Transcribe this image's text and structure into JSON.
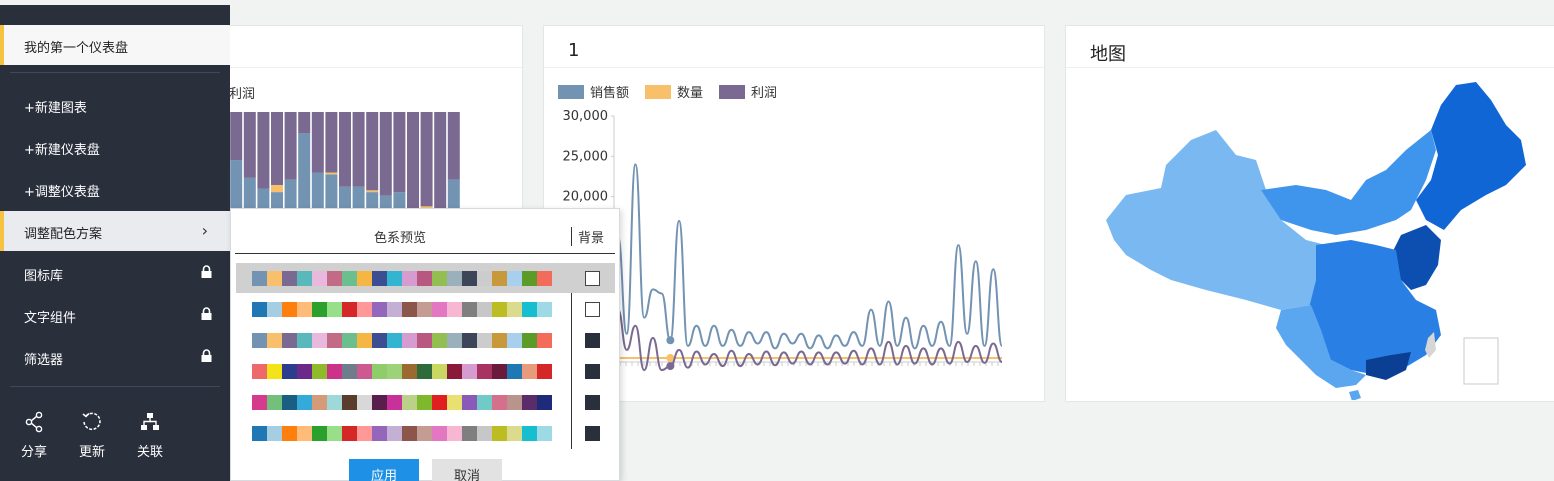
{
  "sidebar": {
    "dashboard_name": "我的第一个仪表盘",
    "items": [
      {
        "label": "+新建图表"
      },
      {
        "label": "+新建仪表盘"
      },
      {
        "label": "+调整仪表盘"
      },
      {
        "label": "调整配色方案"
      },
      {
        "label": "图标库"
      },
      {
        "label": "文字组件"
      },
      {
        "label": "筛选器"
      }
    ],
    "tools": [
      {
        "label": "分享",
        "icon": "share-icon"
      },
      {
        "label": "更新",
        "icon": "refresh-icon"
      },
      {
        "label": "关联",
        "icon": "hierarchy-icon"
      }
    ]
  },
  "cards": {
    "a": {
      "legend_partial": "利润"
    },
    "b": {
      "title": "1",
      "legend": [
        {
          "name": "销售额",
          "color": "#7393b3"
        },
        {
          "name": "数量",
          "color": "#f8c06a"
        },
        {
          "name": "利润",
          "color": "#7a6a91"
        }
      ]
    },
    "c": {
      "title": "地图"
    }
  },
  "popup": {
    "title": "色系预览",
    "bg_label": "背景",
    "apply_label": "应用",
    "cancel_label": "取消",
    "schemes": [
      {
        "colors": [
          "#7393b3",
          "#f8c06a",
          "#7a6a91",
          "#58b8bb",
          "#e8b9dd",
          "#c16b86",
          "#6bbf8f",
          "#f6b644",
          "#3a4e91",
          "#33b5d1",
          "#d79ccf",
          "#b85881",
          "#93bf52",
          "#9ab0ba",
          "#3c4658",
          "#cccccc",
          "#c8993a",
          "#a8d0ee",
          "#5d9b28",
          "#f36b5a"
        ],
        "bg": "light"
      },
      {
        "colors": [
          "#1f78b4",
          "#a6cee3",
          "#ff7f0e",
          "#ffbb78",
          "#2ca02c",
          "#98df8a",
          "#d62728",
          "#ff9896",
          "#9467bd",
          "#c5b0d5",
          "#8c564b",
          "#c49c94",
          "#e377c2",
          "#f7b6d2",
          "#7f7f7f",
          "#c7c7c7",
          "#bcbd22",
          "#dbdb8d",
          "#17becf",
          "#9edae5"
        ],
        "bg": "light"
      },
      {
        "colors": [
          "#7393b3",
          "#f8c06a",
          "#7a6a91",
          "#58b8bb",
          "#e8b9dd",
          "#c16b86",
          "#6bbf8f",
          "#f6b644",
          "#3a4e91",
          "#33b5d1",
          "#d79ccf",
          "#b85881",
          "#93bf52",
          "#9ab0ba",
          "#3c4658",
          "#cccccc",
          "#c8993a",
          "#a8d0ee",
          "#5d9b28",
          "#f36b5a"
        ],
        "bg": "dark"
      },
      {
        "colors": [
          "#ee6a6a",
          "#f2e418",
          "#2d3d8e",
          "#6b2a8a",
          "#8fbb2a",
          "#cc3388",
          "#6e7c8c",
          "#cc5a90",
          "#8fcc6a",
          "#9ed27a",
          "#9a6a30",
          "#2e6a3a",
          "#c8d860",
          "#8a1a3a",
          "#d79ccf",
          "#a83262",
          "#6a1a3a",
          "#1f78b4",
          "#e89b7a",
          "#d62728"
        ],
        "bg": "dark"
      },
      {
        "colors": [
          "#d63a8c",
          "#72c07a",
          "#1a5e82",
          "#33aad9",
          "#d49b78",
          "#9ed8d8",
          "#5a3c2c",
          "#d8d8d8",
          "#5a1e4c",
          "#c8309a",
          "#bbd088",
          "#7fb82c",
          "#e02020",
          "#e8e070",
          "#8a5ab8",
          "#6fcac8",
          "#d5708c",
          "#b8948c",
          "#5a2c6a",
          "#1e2a7a"
        ],
        "bg": "dark"
      },
      {
        "colors": [
          "#1f78b4",
          "#a6cee3",
          "#ff7f0e",
          "#ffbb78",
          "#2ca02c",
          "#98df8a",
          "#d62728",
          "#ff9896",
          "#9467bd",
          "#c5b0d5",
          "#8c564b",
          "#c49c94",
          "#e377c2",
          "#f7b6d2",
          "#7f7f7f",
          "#c7c7c7",
          "#bcbd22",
          "#dbdb8d",
          "#17becf",
          "#9edae5"
        ],
        "bg": "dark"
      }
    ]
  },
  "chart_data": [
    {
      "type": "bar",
      "stacked": true,
      "series": [
        {
          "name": "销售额",
          "color": "#7393b3",
          "values": [
            0.35,
            0.78,
            0.73,
            0.63,
            0.57,
            0.55,
            0.62,
            0.88,
            0.66,
            0.65,
            0.58,
            0.58,
            0.55,
            0.53,
            0.55,
            0.33,
            0.45,
            0.25,
            0.62
          ]
        },
        {
          "name": "数量",
          "color": "#f8c06a",
          "values": [
            0,
            0.04,
            0,
            0,
            0,
            0.04,
            0,
            0,
            0,
            0.01,
            0,
            0,
            0.01,
            0,
            0,
            0,
            0.02,
            0,
            0
          ]
        },
        {
          "name": "利润",
          "color": "#7a6a91",
          "values": [
            0.65,
            0.18,
            0.27,
            0.37,
            0.43,
            0.41,
            0.38,
            0.12,
            0.34,
            0.34,
            0.42,
            0.42,
            0.44,
            0.47,
            0.45,
            0.67,
            0.53,
            0.75,
            0.38
          ]
        }
      ]
    },
    {
      "type": "line",
      "ylim": [
        0,
        30000
      ],
      "yticks": [
        20000,
        25000,
        30000
      ],
      "ytick_labels": [
        "20,000",
        "25,000",
        "30,000"
      ],
      "series": [
        {
          "name": "销售额",
          "color": "#7393b3",
          "values": [
            15000,
            3000,
            24000,
            5000,
            8500,
            8000,
            2200,
            17000,
            1500,
            4000,
            1500,
            4000,
            1500,
            3500,
            1500,
            3200,
            1800,
            3200,
            1200,
            3000,
            1800,
            3000,
            1200,
            2800,
            1200,
            2800,
            1500,
            3200,
            1500,
            6000,
            1500,
            7000,
            1500,
            5000,
            1200,
            4000,
            1500,
            4500,
            1500,
            14000,
            3000,
            12000,
            1500,
            11000,
            1500
          ]
        },
        {
          "name": "数量",
          "color": "#f8c06a",
          "values": [
            0,
            0,
            0,
            0,
            0,
            0,
            0,
            0,
            0,
            0,
            0,
            0,
            0,
            0,
            0,
            0,
            0,
            0,
            0,
            0,
            0,
            0,
            0,
            0,
            0,
            0,
            0,
            0,
            0,
            0,
            0,
            0,
            0,
            0,
            0,
            0,
            0,
            0,
            0,
            0,
            0,
            0,
            0,
            0,
            0
          ]
        },
        {
          "name": "利润",
          "color": "#7a6a91",
          "values": [
            6000,
            1000,
            4000,
            -1500,
            2500,
            -1500,
            -1000,
            1000,
            -1200,
            800,
            -800,
            500,
            -1000,
            900,
            -1000,
            500,
            -800,
            800,
            -900,
            700,
            -700,
            800,
            -800,
            700,
            -800,
            700,
            -700,
            900,
            -800,
            1200,
            -800,
            2000,
            -800,
            1500,
            -700,
            1200,
            -800,
            1200,
            -700,
            2000,
            -500,
            1500,
            -600,
            1800,
            -500
          ]
        }
      ]
    }
  ]
}
